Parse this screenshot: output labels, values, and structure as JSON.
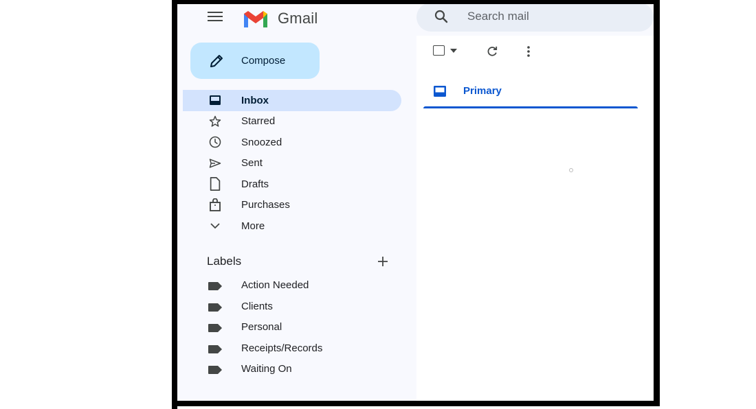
{
  "app": {
    "name": "Gmail"
  },
  "search": {
    "placeholder": "Search mail"
  },
  "compose": {
    "label": "Compose"
  },
  "nav": {
    "items": [
      {
        "label": "Inbox",
        "icon": "inbox-icon",
        "active": true
      },
      {
        "label": "Starred",
        "icon": "star-icon"
      },
      {
        "label": "Snoozed",
        "icon": "clock-icon"
      },
      {
        "label": "Sent",
        "icon": "send-icon"
      },
      {
        "label": "Drafts",
        "icon": "draft-icon"
      },
      {
        "label": "Purchases",
        "icon": "shopping-bag-icon"
      },
      {
        "label": "More",
        "icon": "chevron-down-icon"
      }
    ]
  },
  "labels": {
    "title": "Labels",
    "items": [
      {
        "name": "Action Needed"
      },
      {
        "name": "Clients"
      },
      {
        "name": "Personal"
      },
      {
        "name": "Receipts/Records"
      },
      {
        "name": "Waiting On"
      }
    ]
  },
  "tabs": {
    "primary": {
      "label": "Primary",
      "icon": "inbox-icon"
    }
  },
  "colors": {
    "accent": "#0b57d0",
    "compose_bg": "#c2e7ff",
    "active_nav_bg": "#d3e3fd",
    "app_bg": "#f8f9fe",
    "search_bg": "#e9eef6"
  }
}
